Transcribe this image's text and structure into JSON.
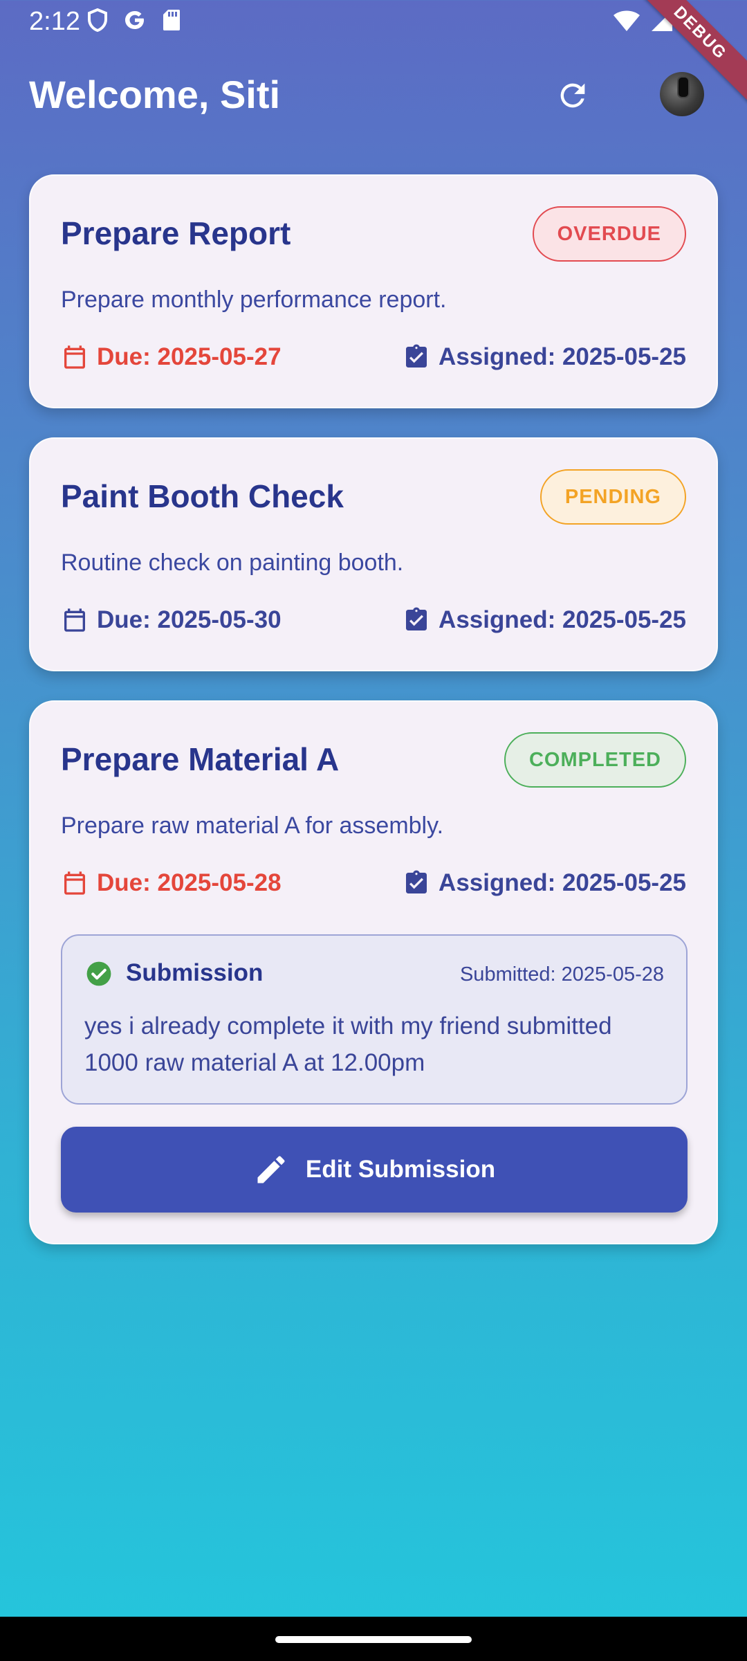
{
  "status_bar": {
    "time": "2:12",
    "left_icons": [
      "shield-icon",
      "google-icon",
      "sd-card-icon"
    ],
    "right_icons": [
      "wifi-icon",
      "signal-icon",
      "battery-icon"
    ]
  },
  "debug_ribbon": "DEBUG",
  "header": {
    "welcome": "Welcome, Siti",
    "refresh_icon": "refresh-icon",
    "avatar": "user-avatar"
  },
  "tasks": [
    {
      "title": "Prepare Report",
      "status": "OVERDUE",
      "status_color": "#e24a50",
      "description": "Prepare monthly performance report.",
      "due": "Due: 2025-05-27",
      "assigned": "Assigned: 2025-05-25"
    },
    {
      "title": "Paint Booth Check",
      "status": "PENDING",
      "status_color": "#f3a325",
      "description": "Routine check on painting booth.",
      "due": "Due: 2025-05-30",
      "assigned": "Assigned: 2025-05-25"
    },
    {
      "title": "Prepare Material A",
      "status": "COMPLETED",
      "status_color": "#4caf5a",
      "description": "Prepare raw material A for assembly.",
      "due": "Due: 2025-05-28",
      "assigned": "Assigned: 2025-05-25",
      "submission": {
        "title": "Submission",
        "submitted": "Submitted: 2025-05-28",
        "text": "yes i already complete it with my friend submitted 1000 raw material A at 12.00pm"
      },
      "edit_button": "Edit Submission"
    }
  ],
  "colors": {
    "primary": "#3f51b5",
    "title": "#28358c",
    "overdue_red": "#e4463b",
    "card_bg": "#f5f0f8"
  }
}
